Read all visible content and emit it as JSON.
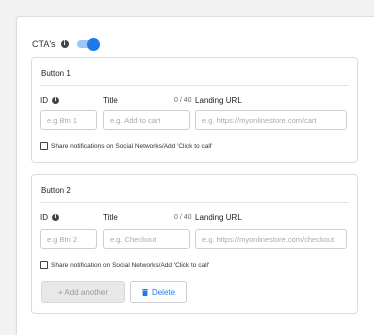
{
  "ctas": {
    "label": "CTA's",
    "toggle_on": true
  },
  "buttons": [
    {
      "title": "Button 1",
      "id_label": "ID",
      "title_label": "Title",
      "counter": "0 / 40",
      "url_label": "Landing URL",
      "id_placeholder": "e.g Btn 1",
      "title_placeholder": "e.g. Add to cart",
      "url_placeholder": "e.g. https://myonlinestore.com/cart",
      "checkbox_label": "Share notifications on Social Networks/Add 'Click to call'"
    },
    {
      "title": "Button 2",
      "id_label": "ID",
      "title_label": "Title",
      "counter": "0 / 40",
      "url_label": "Landing URL",
      "id_placeholder": "e.g Btn 2",
      "title_placeholder": "e.g. Checkout",
      "url_placeholder": "e.g. https://myonlinestore.com/checkout",
      "checkbox_label": "Share notification on Social Networks/Add 'Click to call'"
    }
  ],
  "actions": {
    "add_another": "+ Add another",
    "delete": "Delete"
  },
  "colors": {
    "accent": "#1e7ae8",
    "toggle_track": "#9ec6f7"
  }
}
